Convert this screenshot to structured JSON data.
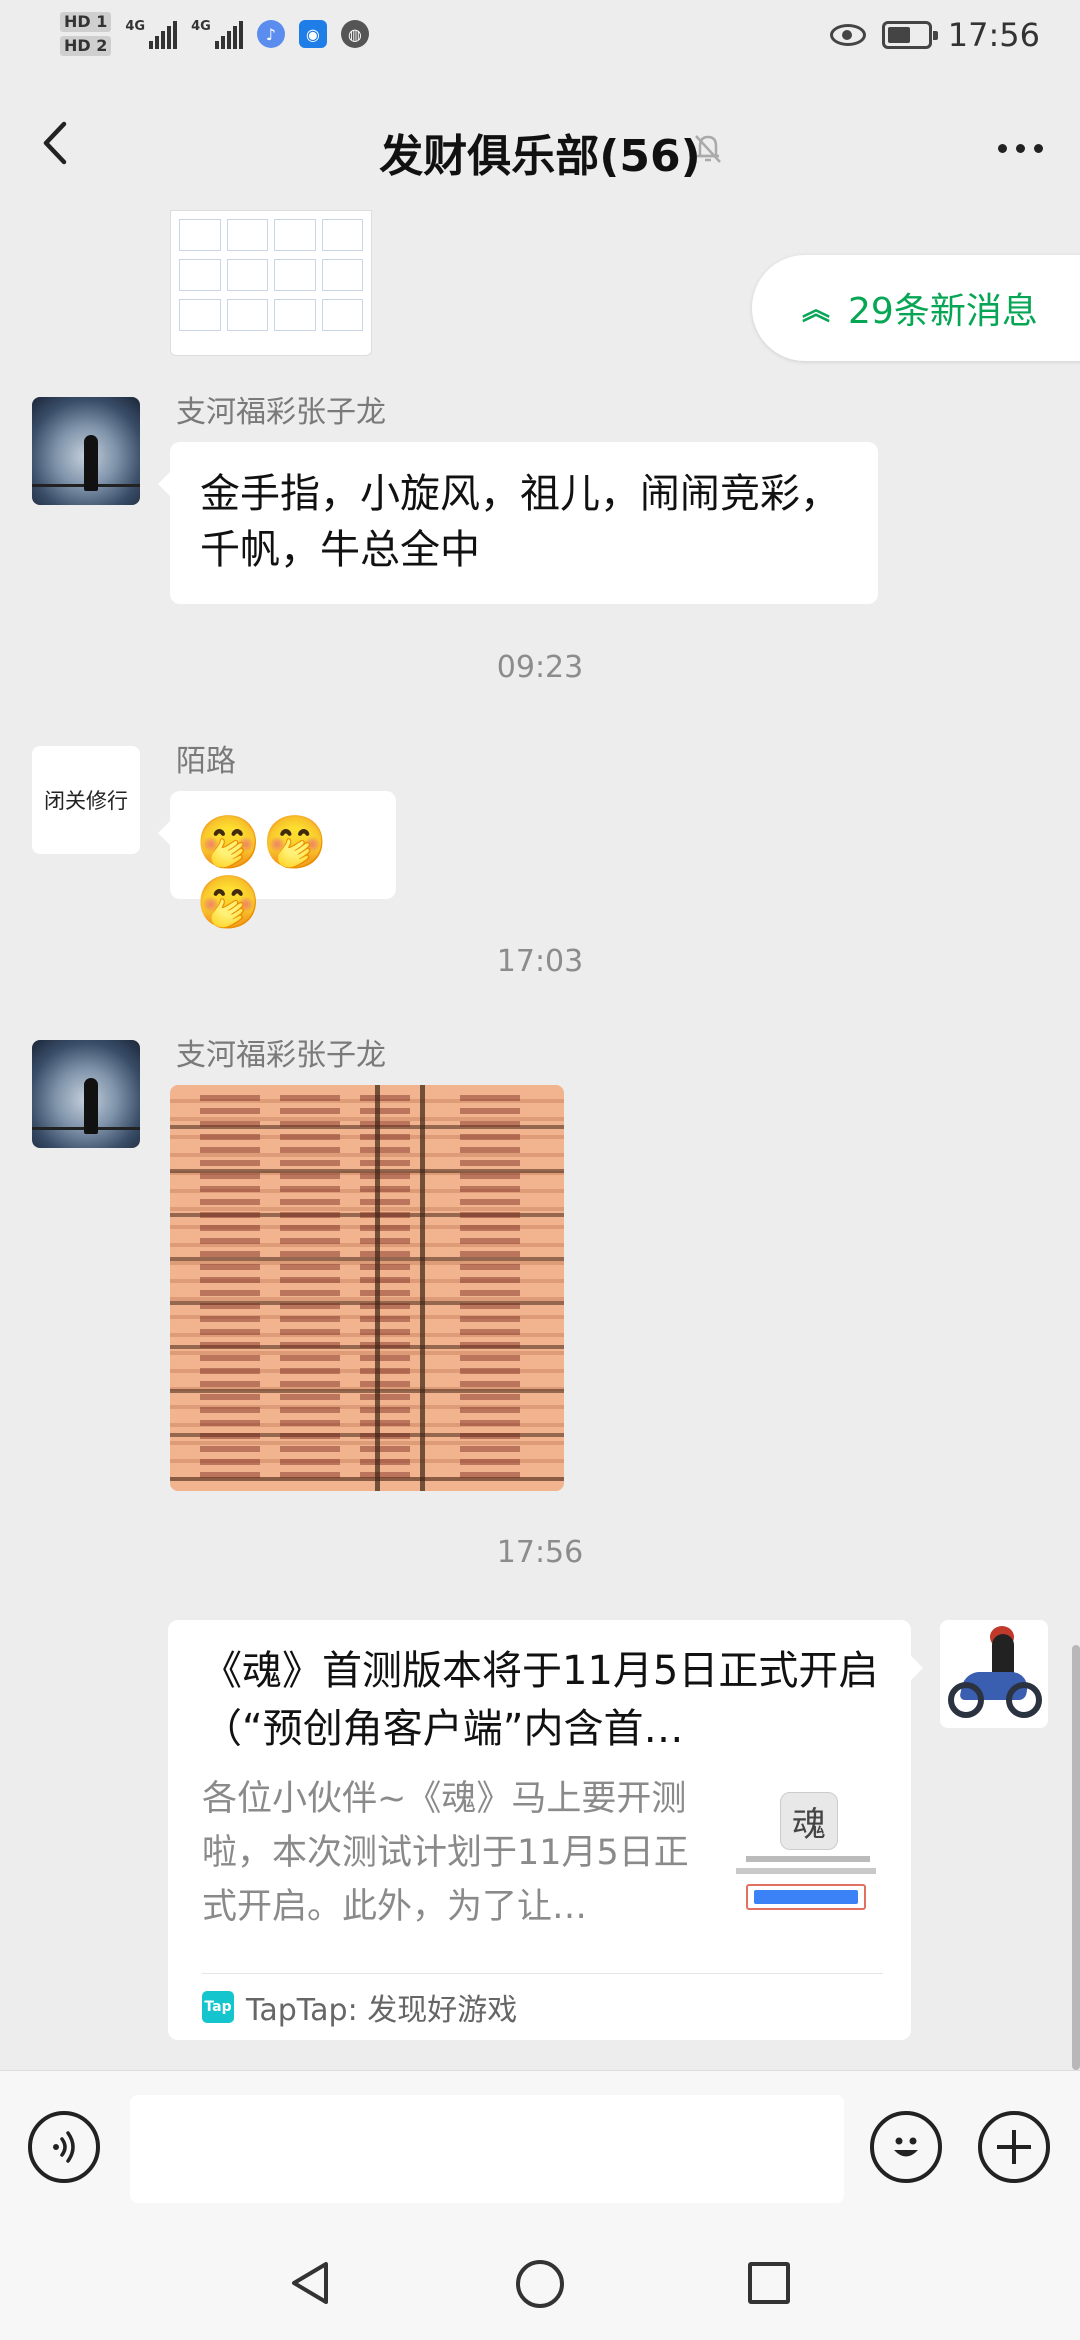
{
  "status_bar": {
    "sim1": "HD 1",
    "sim2": "HD 2",
    "net1": "4G",
    "net2": "4G",
    "time": "17:56"
  },
  "header": {
    "title": "发财俱乐部(56)",
    "muted": true
  },
  "new_messages": {
    "label": "29条新消息"
  },
  "messages": [
    {
      "sender": "支河福彩张子龙",
      "text": "金手指，小旋风，祖儿，闹闹竞彩，千帆，牛总全中"
    },
    {
      "time": "09:23"
    },
    {
      "sender": "陌路",
      "avatar_text": "闭关修行",
      "text": "🤭🤭🤭"
    },
    {
      "time": "17:03"
    },
    {
      "sender": "支河福彩张子龙",
      "type": "image"
    },
    {
      "time": "17:56"
    },
    {
      "type": "link_card",
      "self": true,
      "title": "《魂》首测版本将于11月5日正式开启（“预创角客户端”内含首…",
      "description": "各位小伙伴~《魂》马上要开测啦，本次测试计划于11月5日正式开启。此外，为了让…",
      "source": "TapTap: 发现好游戏",
      "source_icon_text": "Tap"
    }
  ],
  "input_bar": {
    "placeholder": ""
  },
  "icons": {
    "back": "chevron-left-icon",
    "mute": "bell-off-icon",
    "more": "more-dots-icon",
    "voice": "voice-icon",
    "emoji": "emoji-icon",
    "plus": "plus-icon"
  },
  "colors": {
    "accent": "#07a655",
    "background": "#ededed",
    "bubble": "#ffffff"
  }
}
